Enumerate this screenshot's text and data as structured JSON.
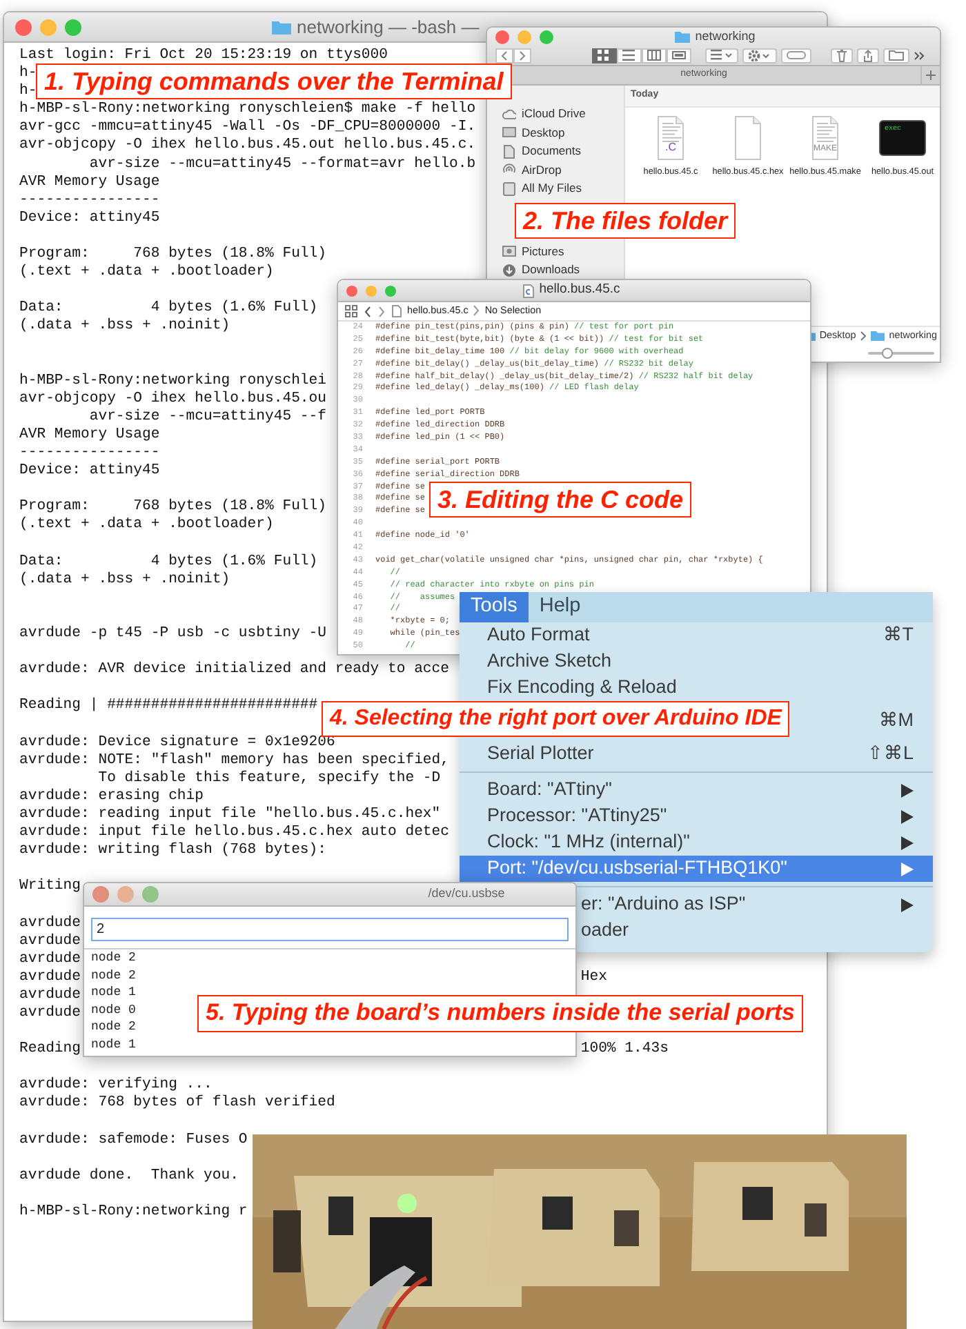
{
  "terminal": {
    "title": "networking — -bash —",
    "lines": [
      {
        "kind": "text",
        "text": "Last login: Fri Oct 20 15:23:19 on ttys000"
      },
      {
        "kind": "text",
        "text": "h-"
      },
      {
        "kind": "text",
        "text": "h-"
      },
      {
        "kind": "text",
        "text": "h-MBP-sl-Rony:networking ronyschleien$ make -f hello"
      },
      {
        "kind": "text",
        "text": "avr-gcc -mmcu=attiny45 -Wall -Os -DF_CPU=8000000 -I."
      },
      {
        "kind": "text",
        "text": "avr-objcopy -O ihex hello.bus.45.out hello.bus.45.c."
      },
      {
        "kind": "text",
        "text": "        avr-size --mcu=attiny45 --format=avr hello.b"
      },
      {
        "kind": "text",
        "text": "AVR Memory Usage"
      },
      {
        "kind": "text",
        "text": "----------------"
      },
      {
        "kind": "text",
        "text": "Device: attiny45"
      },
      {
        "kind": "blank"
      },
      {
        "kind": "text",
        "text": "Program:     768 bytes (18.8% Full)"
      },
      {
        "kind": "text",
        "text": "(.text + .data + .bootloader)"
      },
      {
        "kind": "blank"
      },
      {
        "kind": "text",
        "text": "Data:          4 bytes (1.6% Full)"
      },
      {
        "kind": "text",
        "text": "(.data + .bss + .noinit)"
      },
      {
        "kind": "blank"
      },
      {
        "kind": "blank"
      },
      {
        "kind": "text",
        "text": "h-MBP-sl-Rony:networking ronyschlei"
      },
      {
        "kind": "text",
        "text": "avr-objcopy -O ihex hello.bus.45.ou"
      },
      {
        "kind": "text",
        "text": "        avr-size --mcu=attiny45 --f"
      },
      {
        "kind": "text",
        "text": "AVR Memory Usage"
      },
      {
        "kind": "text",
        "text": "----------------"
      },
      {
        "kind": "text",
        "text": "Device: attiny45"
      },
      {
        "kind": "blank"
      },
      {
        "kind": "text",
        "text": "Program:     768 bytes (18.8% Full)"
      },
      {
        "kind": "text",
        "text": "(.text + .data + .bootloader)"
      },
      {
        "kind": "blank"
      },
      {
        "kind": "text",
        "text": "Data:          4 bytes (1.6% Full)"
      },
      {
        "kind": "text",
        "text": "(.data + .bss + .noinit)"
      },
      {
        "kind": "blank"
      },
      {
        "kind": "blank"
      },
      {
        "kind": "text",
        "text": "avrdude -p t45 -P usb -c usbtiny -U"
      },
      {
        "kind": "blank"
      },
      {
        "kind": "text",
        "text": "avrdude: AVR device initialized and ready to acce"
      },
      {
        "kind": "blank"
      },
      {
        "kind": "text",
        "text": "Reading | ########################"
      },
      {
        "kind": "blank"
      },
      {
        "kind": "text",
        "text": "avrdude: Device signature = 0x1e9206"
      },
      {
        "kind": "text",
        "text": "avrdude: NOTE: \"flash\" memory has been specified,"
      },
      {
        "kind": "text",
        "text": "         To disable this feature, specify the -D"
      },
      {
        "kind": "text",
        "text": "avrdude: erasing chip"
      },
      {
        "kind": "text",
        "text": "avrdude: reading input file \"hello.bus.45.c.hex\""
      },
      {
        "kind": "text",
        "text": "avrdude: input file hello.bus.45.c.hex auto detec"
      },
      {
        "kind": "text",
        "text": "avrdude: writing flash (768 bytes):"
      },
      {
        "kind": "blank"
      },
      {
        "kind": "text",
        "text": "Writing"
      },
      {
        "kind": "blank"
      },
      {
        "kind": "text",
        "text": "avrdude"
      },
      {
        "kind": "text",
        "text": "avrdude"
      },
      {
        "kind": "text",
        "text": "avrdude"
      },
      {
        "kind": "text",
        "text": "avrdude",
        "right": "Hex"
      },
      {
        "kind": "text",
        "text": "avrdude"
      },
      {
        "kind": "text",
        "text": "avrdude"
      },
      {
        "kind": "blank"
      },
      {
        "kind": "text",
        "text": "Reading",
        "right": "100% 1.43s"
      },
      {
        "kind": "blank"
      },
      {
        "kind": "text",
        "text": "avrdude: verifying ..."
      },
      {
        "kind": "text",
        "text": "avrdude: 768 bytes of flash verified"
      },
      {
        "kind": "blank"
      },
      {
        "kind": "text",
        "text": "avrdude: safemode: Fuses O"
      },
      {
        "kind": "blank"
      },
      {
        "kind": "text",
        "text": "avrdude done.  Thank you."
      },
      {
        "kind": "blank"
      },
      {
        "kind": "text",
        "text": "h-MBP-sl-Rony:networking r"
      }
    ]
  },
  "finder": {
    "title": "networking",
    "views": [
      {
        "kind": "icons",
        "selected": true
      },
      {
        "kind": "list",
        "selected": false
      },
      {
        "kind": "columns",
        "selected": false
      },
      {
        "kind": "gallery",
        "selected": false
      }
    ],
    "tab": "networking",
    "sidebar": [
      [
        {
          "kind": "cloud",
          "label": "iCloud Drive"
        },
        {
          "kind": "desktop",
          "label": "Desktop"
        },
        {
          "kind": "documents",
          "label": "Documents"
        },
        {
          "kind": "airdrop",
          "label": "AirDrop"
        },
        {
          "kind": "files",
          "label": "All My Files"
        }
      ],
      [
        {
          "kind": "pictures",
          "label": "Pictures"
        },
        {
          "kind": "downloads",
          "label": "Downloads"
        }
      ]
    ],
    "section": "Today",
    "files": [
      {
        "kind": "source",
        "name": "hello.bus.45.c",
        "badge": ".C"
      },
      {
        "kind": "blank",
        "name": "hello.bus.45.c.hex"
      },
      {
        "kind": "make",
        "name": "hello.bus.45.make",
        "badge": "MAKE"
      },
      {
        "kind": "exec",
        "name": "hello.bus.45.out",
        "badge": "exec"
      }
    ],
    "path": [
      "Desktop",
      "networking"
    ],
    "icon_size": {
      "level": 0.3
    }
  },
  "editor": {
    "title": "hello.bus.45.c",
    "crumb_file": "hello.bus.45.c",
    "crumb_selection": "No Selection",
    "lines": [
      {
        "n": "24",
        "kind": "top",
        "code": "#define pin_test(pins,pin) (pins & pin)",
        "comment": "// test for port pin"
      },
      {
        "n": "25",
        "kind": "top",
        "code": "#define bit_test(byte,bit) (byte & (1 << bit))",
        "comment": "// test for bit set"
      },
      {
        "n": "26",
        "kind": "top",
        "code": "#define bit_delay_time 100",
        "comment": "// bit delay for 9600 with overhead"
      },
      {
        "n": "27",
        "kind": "top",
        "code": "#define bit_delay() _delay_us(bit_delay_time)",
        "comment": "// RS232 bit delay"
      },
      {
        "n": "28",
        "kind": "top",
        "code": "#define half_bit_delay() _delay_us(bit_delay_time/2)",
        "comment": "// RS232 half bit delay"
      },
      {
        "n": "29",
        "kind": "top",
        "code": "#define led_delay() _delay_ms(100)",
        "comment": "// LED flash delay"
      },
      {
        "n": "30",
        "kind": "top"
      },
      {
        "n": "31",
        "kind": "top",
        "code": "#define led_port PORTB"
      },
      {
        "n": "32",
        "kind": "top",
        "code": "#define led_direction DDRB"
      },
      {
        "n": "33",
        "kind": "top",
        "code": "#define led_pin (1 << PB0)"
      },
      {
        "n": "34",
        "kind": "top"
      },
      {
        "n": "35",
        "kind": "top",
        "code": "#define serial_port PORTB"
      },
      {
        "n": "36",
        "kind": "top",
        "code": "#define serial_direction DDRB"
      },
      {
        "n": "37",
        "kind": "top",
        "code": "#define se"
      },
      {
        "n": "38",
        "kind": "top",
        "code": "#define se"
      },
      {
        "n": "39",
        "kind": "top",
        "code": "#define se"
      },
      {
        "n": "40",
        "kind": "top"
      },
      {
        "n": "41",
        "kind": "top",
        "code": "#define node_id '0'"
      },
      {
        "n": "42",
        "kind": "top"
      },
      {
        "n": "43",
        "kind": "top",
        "code": "void get_char(volatile unsigned char *pins, unsigned char pin, char *rxbyte) {"
      },
      {
        "n": "44",
        "kind": "body",
        "comment": "//"
      },
      {
        "n": "45",
        "kind": "body",
        "comment": "// read character into rxbyte on pins pin"
      },
      {
        "n": "46",
        "kind": "body",
        "comment": "//    assumes"
      },
      {
        "n": "47",
        "kind": "body",
        "comment": "//"
      },
      {
        "n": "48",
        "kind": "body",
        "code": "*rxbyte = 0;"
      },
      {
        "n": "49",
        "kind": "body",
        "code": "while (pin_tes"
      },
      {
        "n": "50",
        "kind": "nested",
        "comment": "//"
      }
    ]
  },
  "arduino": {
    "menus": [
      {
        "label": "Tools",
        "selected": true
      },
      {
        "label": "Help",
        "selected": false
      }
    ],
    "items": [
      {
        "kind": "command",
        "label": "Auto Format",
        "shortcut": "⌘T",
        "submenu": false,
        "selected": false
      },
      {
        "kind": "command",
        "label": "Archive Sketch",
        "submenu": false,
        "selected": false
      },
      {
        "kind": "command",
        "label": "Fix Encoding & Reload",
        "submenu": false,
        "selected": false
      },
      {
        "kind": "command",
        "shortcut": "⌘M",
        "submenu": false,
        "selected": false
      },
      {
        "kind": "command",
        "label": "Serial Plotter",
        "shortcut": "⇧⌘L",
        "submenu": false,
        "selected": false
      },
      {
        "kind": "separator"
      },
      {
        "kind": "command",
        "label": "Board: \"ATtiny\"",
        "submenu": true,
        "selected": false
      },
      {
        "kind": "command",
        "label": "Processor: \"ATtiny25\"",
        "submenu": true,
        "selected": false
      },
      {
        "kind": "command",
        "label": "Clock: \"1 MHz (internal)\"",
        "submenu": true,
        "selected": false
      },
      {
        "kind": "command",
        "label": "Port: \"/dev/cu.usbserial-FTHBQ1K0\"",
        "submenu": true,
        "selected": true
      },
      {
        "kind": "separator"
      },
      {
        "kind": "partial",
        "label": "er: \"Arduino as ISP\"",
        "submenu": true,
        "selected": false
      },
      {
        "kind": "partial",
        "label": "oader",
        "submenu": false,
        "selected": false
      }
    ]
  },
  "serial": {
    "title": "/dev/cu.usbse",
    "input": "2",
    "output": [
      "node 2",
      "node 2",
      "node 1",
      "node 0",
      "node 2",
      "node 1"
    ]
  },
  "photo": {
    "kind": "picture"
  },
  "callouts": [
    "1. Typing commands over the Terminal",
    "2. The files folder",
    "3. Editing the C code",
    "4. Selecting the right port over Arduino IDE",
    "5. Typing the board’s numbers inside the serial ports"
  ]
}
